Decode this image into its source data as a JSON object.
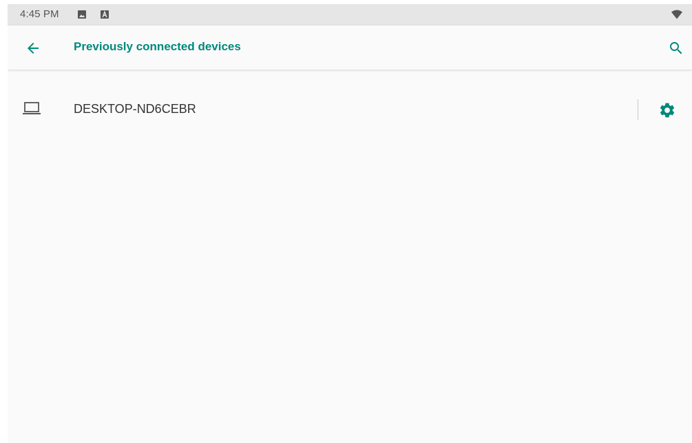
{
  "status_bar": {
    "time": "4:45 PM",
    "notification_icons": [
      "image-icon",
      "a-box-icon"
    ],
    "wifi_icon": "wifi-icon"
  },
  "toolbar": {
    "title": "Previously connected devices",
    "back_icon": "arrow-back-icon",
    "search_icon": "search-icon"
  },
  "devices": [
    {
      "name": "DESKTOP-ND6CEBR",
      "icon": "laptop-icon",
      "settings_icon": "gear-icon"
    }
  ],
  "colors": {
    "accent": "#00897b",
    "status_bar_bg": "#e6e6e6",
    "background": "#fafafa",
    "text_primary": "#333333"
  }
}
